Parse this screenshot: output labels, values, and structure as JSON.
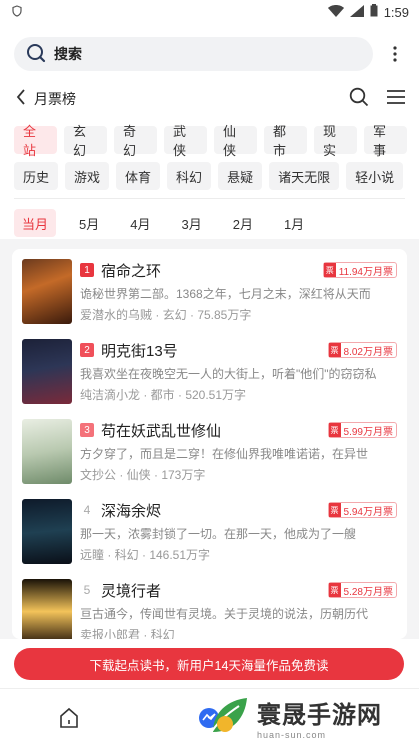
{
  "statusbar": {
    "time": "1:59"
  },
  "search": {
    "label": "搜索"
  },
  "header": {
    "title": "月票榜"
  },
  "categories": {
    "row1": [
      "全站",
      "玄幻",
      "奇幻",
      "武侠",
      "仙侠",
      "都市",
      "现实",
      "军事"
    ],
    "row2": [
      "历史",
      "游戏",
      "体育",
      "科幻",
      "悬疑",
      "诸天无限",
      "轻小说"
    ],
    "selected": "全站"
  },
  "months": {
    "items": [
      "当月",
      "5月",
      "4月",
      "3月",
      "2月",
      "1月"
    ],
    "selected": "当月"
  },
  "books": [
    {
      "rank": "1",
      "title": "宿命之环",
      "votes": "11.94万月票",
      "desc": "诡秘世界第二部。1368之年，七月之末，深红将从天而",
      "author": "爱潜水的乌贼",
      "category": "玄幻",
      "words": "75.85万字",
      "rank_color": "#e8363f"
    },
    {
      "rank": "2",
      "title": "明克街13号",
      "votes": "8.02万月票",
      "desc": "我喜欢坐在夜晚空无一人的大街上，听着\"他们\"的窃窃私",
      "author": "纯洁滴小龙",
      "category": "都市",
      "words": "520.51万字",
      "rank_color": "#f0505a"
    },
    {
      "rank": "3",
      "title": "苟在妖武乱世修仙",
      "votes": "5.99万月票",
      "desc": "方夕穿了，而且是二穿！在修仙界我唯唯诺诺，在异世",
      "author": "文抄公",
      "category": "仙侠",
      "words": "173万字",
      "rank_color": "#f4727a"
    },
    {
      "rank": "4",
      "title": "深海余烬",
      "votes": "5.94万月票",
      "desc": "那一天，浓雾封锁了一切。在那一天，他成为了一艘",
      "author": "远瞳",
      "category": "科幻",
      "words": "146.51万字",
      "rank_color": ""
    },
    {
      "rank": "5",
      "title": "灵境行者",
      "votes": "5.28万月票",
      "desc": "亘古通今，传闻世有灵境。关于灵境的说法，历朝历代",
      "author": "卖报小郎君",
      "category": "科幻",
      "words": "",
      "rank_color": ""
    }
  ],
  "banner": {
    "text": "下载起点读书，新用户14天海量作品免费读"
  },
  "watermark": {
    "title": "寰晟手游网",
    "sub": "huan-sun.com"
  }
}
